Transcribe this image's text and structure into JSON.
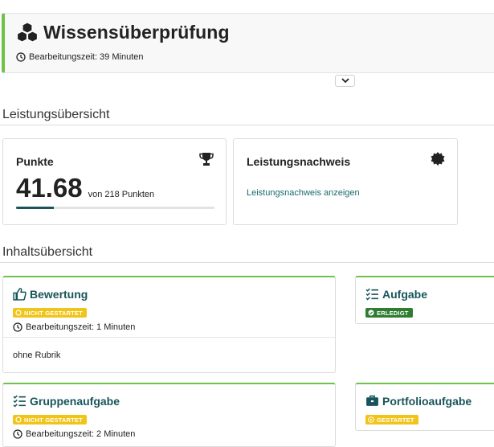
{
  "header": {
    "title": "Wissensüberprüfung",
    "time_label": "Bearbeitungszeit: 39 Minuten",
    "accent": "#6cc24a"
  },
  "performance": {
    "section_title": "Leistungsübersicht",
    "points_card": {
      "label": "Punkte",
      "value": "41.68",
      "of_text": "von 218 Punkten",
      "progress_fraction": 0.19,
      "icon": "trophy-icon"
    },
    "certificate_card": {
      "label": "Leistungsnachweis",
      "link": "Leistungsnachweis anzeigen",
      "icon": "badge-seal-icon"
    }
  },
  "content": {
    "section_title": "Inhaltsübersicht",
    "cards": [
      {
        "title": "Bewertung",
        "icon": "thumbs-up-icon",
        "status": "NICHT GESTARTET",
        "status_color": "#f0c419",
        "time": "Bearbeitungszeit: 1 Minuten",
        "rubric": "ohne Rubrik"
      },
      {
        "title": "Aufgabe",
        "icon": "checklist-icon",
        "status": "ERLEDIGT",
        "status_color": "#2e7d32"
      },
      {
        "title": "Gruppenaufgabe",
        "icon": "checklist-icon",
        "status": "NICHT GESTARTET",
        "status_color": "#f0c419",
        "time": "Bearbeitungszeit: 2 Minuten"
      },
      {
        "title": "Portfolioaufgabe",
        "icon": "briefcase-icon",
        "status": "GESTARTET",
        "status_color": "#f0c419"
      }
    ]
  },
  "colors": {
    "teal": "#17555a",
    "link": "#1a6a6e",
    "green": "#6cc24a"
  }
}
